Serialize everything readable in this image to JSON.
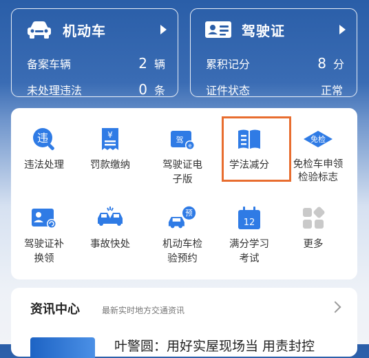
{
  "vehicle_card": {
    "title": "机动车",
    "icon": "car-icon",
    "rows": [
      {
        "label": "备案车辆",
        "value": "2",
        "unit": "辆"
      },
      {
        "label": "未处理违法",
        "value": "0",
        "unit": "条"
      }
    ]
  },
  "license_card": {
    "title": "驾驶证",
    "icon": "license-card-icon",
    "rows": [
      {
        "label": "累积记分",
        "value": "8",
        "unit": "分"
      },
      {
        "label": "证件状态",
        "value": "正常",
        "unit": ""
      }
    ]
  },
  "services": [
    {
      "label": "违法处理",
      "icon": "violation-icon"
    },
    {
      "label": "罚款缴纳",
      "icon": "fine-receipt-icon"
    },
    {
      "label": "驾驶证电\n子版",
      "icon": "e-license-icon"
    },
    {
      "label": "学法减分",
      "icon": "book-icon"
    },
    {
      "label": "免检车申领\n检验标志",
      "icon": "inspection-exempt-icon",
      "badge": "免检"
    },
    {
      "label": "驾驶证补\n换领",
      "icon": "license-renew-icon"
    },
    {
      "label": "事故快处",
      "icon": "accident-icon"
    },
    {
      "label": "机动车检\n验预约",
      "icon": "inspection-booking-icon",
      "badge": "预"
    },
    {
      "label": "满分学习\n考试",
      "icon": "calendar-12-icon",
      "badge": "12"
    },
    {
      "label": "更多",
      "icon": "more-grid-icon"
    }
  ],
  "news": {
    "title": "资讯中心",
    "subtitle": "最新实时地方交通资讯",
    "headline": "叶警圆：用好实屋现场当 用责封控"
  },
  "colors": {
    "brand_blue": "#2a5ea8",
    "icon_blue": "#2f7be5",
    "highlight_orange": "#e86d2f"
  }
}
